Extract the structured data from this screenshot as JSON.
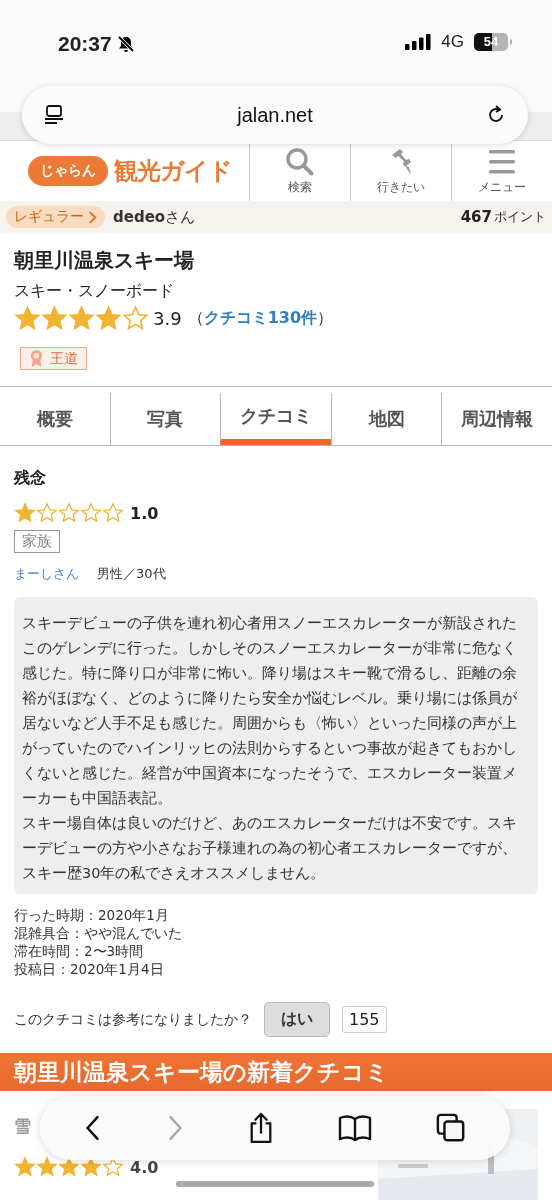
{
  "status_bar": {
    "time": "20:37",
    "network": "4G",
    "battery": "54",
    "muted": true
  },
  "browser": {
    "url": "jalan.net",
    "forward_enabled": false
  },
  "site_header": {
    "logo_mark": "じゃらん",
    "logo_text": "観光ガイド",
    "nav": [
      {
        "label": "検索",
        "kind": "search"
      },
      {
        "label": "行きたい",
        "kind": "pin"
      },
      {
        "label": "メニュー",
        "kind": "menu"
      }
    ]
  },
  "member_bar": {
    "rank": "レギュラー",
    "user": "**dedeo**さん",
    "points": "467",
    "points_unit": "ポイント"
  },
  "spot": {
    "name": "朝里川温泉スキー場",
    "category": "スキー・スノーボード",
    "stars": 4,
    "rating": "3.9",
    "review_count": {
      "before": "（",
      "link": "クチコミ130件",
      "after": "）"
    },
    "badge": "王道"
  },
  "tabs": [
    {
      "label": "概要",
      "selected": false
    },
    {
      "label": "写真",
      "selected": false
    },
    {
      "label": "クチコミ",
      "selected": true
    },
    {
      "label": "地図",
      "selected": false
    },
    {
      "label": "周辺情報",
      "selected": false
    }
  ],
  "review": {
    "title": "残念",
    "stars": 1,
    "rating": "1.0",
    "tag": "家族",
    "author": "まーしさん",
    "author_info": "男性／30代",
    "body": [
      "スキーデビューの子供を連れ初心者用スノーエスカレーターが新設されたこのゲレンデに行った。しかしそのスノーエスカレーターが非常に危なく感じた。特に降り口が非常に怖い。降り場はスキー靴で滑るし、距離の余裕がほぼなく、どのように降りたら安全か悩むレベル。乗り場には係員が居ないなど人手不足も感じた。周囲からも〈怖い〉といった同様の声が上がっていたのでハインリッヒの法則からするといつ事故が起きてもおかしくないと感じた。経営が中国資本になったそうで、エスカレーター装置メーカーも中国語表記。",
      "スキー場自体は良いのだけど、あのエスカレーターだけは不安です。スキーデビューの方や小さなお子様連れの為の初心者エスカレーターですが、スキー歴30年の私でさえオススメしません。"
    ],
    "details": [
      "行った時期：2020年1月",
      "混雑具合：やや混んでいた",
      "滞在時間：2〜3時間",
      "投稿日：2020年1月4日"
    ],
    "helpful": {
      "question": "このクチコミは参考になりましたか？",
      "button": "はい",
      "count": "155"
    }
  },
  "new_reviews": {
    "heading": "朝里川温泉スキー場の新着クチコミ",
    "items": [
      {
        "title": "雪",
        "stars": 4,
        "rating": "4.0",
        "kind": "picture"
      }
    ]
  }
}
